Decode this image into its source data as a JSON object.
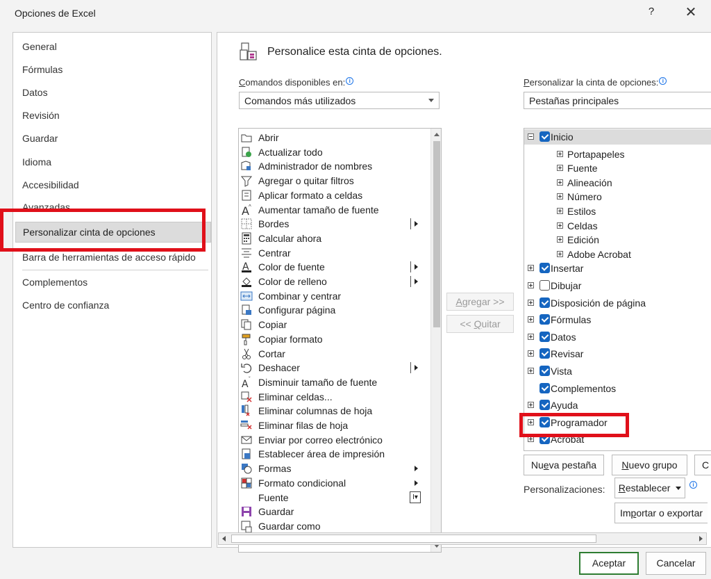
{
  "window": {
    "title": "Opciones de Excel",
    "help": "?",
    "close": "✕"
  },
  "nav": {
    "items": [
      "General",
      "Fórmulas",
      "Datos",
      "Revisión",
      "Guardar",
      "Idioma",
      "Accesibilidad",
      "Avanzadas",
      "Personalizar cinta de opciones",
      "Barra de herramientas de acceso rápido",
      "Complementos",
      "Centro de confianza"
    ],
    "selected_index": 8
  },
  "header": {
    "title": "Personalice esta cinta de opciones."
  },
  "available": {
    "label_prefix": "C",
    "label_rest": "omandos disponibles en:",
    "value": "Comandos más utilizados"
  },
  "customize": {
    "label_prefix": "P",
    "label_rest": "ersonalizar la cinta de opciones:",
    "value": "Pestañas principales"
  },
  "commands": [
    {
      "label": "Abrir",
      "icon": "open-folder-icon"
    },
    {
      "label": "Actualizar todo",
      "icon": "refresh-all-icon"
    },
    {
      "label": "Administrador de nombres",
      "icon": "name-manager-icon"
    },
    {
      "label": "Agregar o quitar filtros",
      "icon": "filter-icon"
    },
    {
      "label": "Aplicar formato a celdas",
      "icon": "format-cells-icon"
    },
    {
      "label": "Aumentar tamaño de fuente",
      "icon": "increase-font-icon"
    },
    {
      "label": "Bordes",
      "icon": "borders-icon",
      "submenu": "split"
    },
    {
      "label": "Calcular ahora",
      "icon": "calculator-icon"
    },
    {
      "label": "Centrar",
      "icon": "center-align-icon"
    },
    {
      "label": "Color de fuente",
      "icon": "font-color-icon",
      "submenu": "split"
    },
    {
      "label": "Color de relleno",
      "icon": "fill-color-icon",
      "submenu": "split"
    },
    {
      "label": "Combinar y centrar",
      "icon": "merge-center-icon"
    },
    {
      "label": "Configurar página",
      "icon": "page-setup-icon"
    },
    {
      "label": "Copiar",
      "icon": "copy-icon"
    },
    {
      "label": "Copiar formato",
      "icon": "format-painter-icon"
    },
    {
      "label": "Cortar",
      "icon": "scissors-icon"
    },
    {
      "label": "Deshacer",
      "icon": "undo-icon",
      "submenu": "split"
    },
    {
      "label": "Disminuir tamaño de fuente",
      "icon": "decrease-font-icon"
    },
    {
      "label": "Eliminar celdas...",
      "icon": "delete-cells-icon"
    },
    {
      "label": "Eliminar columnas de hoja",
      "icon": "delete-columns-icon"
    },
    {
      "label": "Eliminar filas de hoja",
      "icon": "delete-rows-icon"
    },
    {
      "label": "Enviar por correo electrónico",
      "icon": "email-icon"
    },
    {
      "label": "Establecer área de impresión",
      "icon": "print-area-icon"
    },
    {
      "label": "Formas",
      "icon": "shapes-icon",
      "submenu": "arrow"
    },
    {
      "label": "Formato condicional",
      "icon": "conditional-format-icon",
      "submenu": "arrow"
    },
    {
      "label": "Fuente",
      "icon": "",
      "submenu": "combo"
    },
    {
      "label": "Guardar",
      "icon": "save-icon"
    },
    {
      "label": "Guardar como",
      "icon": "save-as-icon"
    }
  ],
  "buttons": {
    "add_prefix": "A",
    "add_rest": "gregar >>",
    "remove_prefix": "<< ",
    "remove_key": "Q",
    "remove_rest": "uitar",
    "new_tab_a": "Nu",
    "new_tab_key": "e",
    "new_tab_b": "va pestaña",
    "new_group_key": "N",
    "new_group_rest": "uevo grupo",
    "rename_partial": "C",
    "customizations_label": "Personalizaciones:",
    "reset_key": "R",
    "reset_rest": "establecer",
    "import_a": "Im",
    "import_key": "p",
    "import_b": "ortar o exportar",
    "ok": "Aceptar",
    "cancel": "Cancelar"
  },
  "tree": [
    {
      "label": "Inicio",
      "level": 0,
      "expand": "minus",
      "checked": true,
      "selected": true
    },
    {
      "label": "Portapapeles",
      "level": 1,
      "expand": "plus"
    },
    {
      "label": "Fuente",
      "level": 1,
      "expand": "plus"
    },
    {
      "label": "Alineación",
      "level": 1,
      "expand": "plus"
    },
    {
      "label": "Número",
      "level": 1,
      "expand": "plus"
    },
    {
      "label": "Estilos",
      "level": 1,
      "expand": "plus"
    },
    {
      "label": "Celdas",
      "level": 1,
      "expand": "plus"
    },
    {
      "label": "Edición",
      "level": 1,
      "expand": "plus"
    },
    {
      "label": "Adobe Acrobat",
      "level": 1,
      "expand": "plus"
    },
    {
      "label": "Insertar",
      "level": 0,
      "expand": "plus",
      "checked": true
    },
    {
      "label": "Dibujar",
      "level": 0,
      "expand": "plus",
      "checked": false
    },
    {
      "label": "Disposición de página",
      "level": 0,
      "expand": "plus",
      "checked": true
    },
    {
      "label": "Fórmulas",
      "level": 0,
      "expand": "plus",
      "checked": true
    },
    {
      "label": "Datos",
      "level": 0,
      "expand": "plus",
      "checked": true
    },
    {
      "label": "Revisar",
      "level": 0,
      "expand": "plus",
      "checked": true
    },
    {
      "label": "Vista",
      "level": 0,
      "expand": "plus",
      "checked": true
    },
    {
      "label": "Complementos",
      "level": 0,
      "expand": "none",
      "checked": true
    },
    {
      "label": "Ayuda",
      "level": 0,
      "expand": "plus",
      "checked": true
    },
    {
      "label": "Programador",
      "level": 0,
      "expand": "plus",
      "checked": true
    },
    {
      "label": "Acrobat",
      "level": 0,
      "expand": "plus",
      "checked": true
    }
  ],
  "colors": {
    "highlight": "#e0101a",
    "check": "#1565c0",
    "ok_border": "#2e7d32"
  }
}
